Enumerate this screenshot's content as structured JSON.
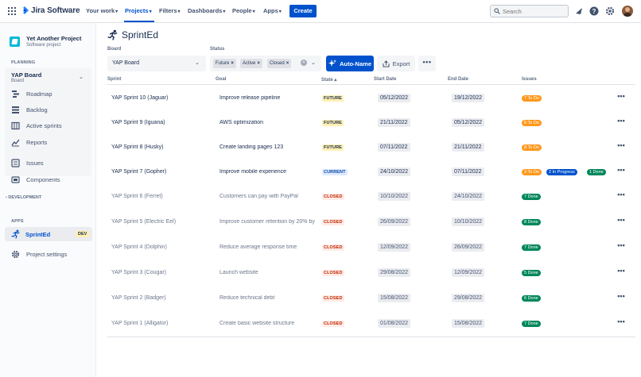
{
  "topnav": {
    "app_name": "Jira Software",
    "items": [
      {
        "label": "Your work",
        "chev": "▾"
      },
      {
        "label": "Projects",
        "chev": "▾"
      },
      {
        "label": "Filters",
        "chev": "▾"
      },
      {
        "label": "Dashboards",
        "chev": "▾"
      },
      {
        "label": "People",
        "chev": "▾"
      },
      {
        "label": "Apps",
        "chev": "▾"
      }
    ],
    "active_item": "Projects",
    "create_label": "Create",
    "search_placeholder": "Search",
    "icons": [
      "notifications-icon",
      "help-icon",
      "settings-icon"
    ],
    "accent": "#0052cc"
  },
  "sidebar": {
    "project_name": "Yet Another Project",
    "project_type": "Software project",
    "planning_label": "PLANNING",
    "board_title": "YAP Board",
    "board_sub": "Board",
    "planning_items": [
      {
        "label": "Roadmap",
        "icon": "roadmap-icon"
      },
      {
        "label": "Backlog",
        "icon": "backlog-icon"
      },
      {
        "label": "Active sprints",
        "icon": "board-icon"
      },
      {
        "label": "Reports",
        "icon": "reports-icon"
      }
    ],
    "other_items": [
      {
        "label": "Issues",
        "icon": "issues-icon"
      },
      {
        "label": "Components",
        "icon": "components-icon"
      }
    ],
    "development_label": "DEVELOPMENT",
    "apps_label": "APPS",
    "app_item": {
      "label": "SprintEd",
      "badge": "DEV"
    },
    "settings_label": "Project settings"
  },
  "main": {
    "title": "SprintEd",
    "board_label": "Board",
    "board_value": "YAP Board",
    "status_label": "Status",
    "status_chips": [
      "Future",
      "Active",
      "Closed"
    ],
    "autoname_label": "Auto-Name",
    "export_label": "Export",
    "more_label": "•••"
  },
  "table": {
    "headers": {
      "sprint": "Sprint",
      "goal": "Goal",
      "state": "State",
      "start": "Start Date",
      "end": "End Date",
      "issues": "Issues"
    },
    "rows": [
      {
        "name": "YAP Sprint 10 (Jaguar)",
        "goal": "Improve release pipeline",
        "state": "FUTURE",
        "start": "05/12/2022",
        "end": "19/12/2022",
        "badges": [
          {
            "text": "7 To Do",
            "kind": "todo"
          }
        ]
      },
      {
        "name": "YAP Sprint 9 (Iguana)",
        "goal": "AWS optimization",
        "state": "FUTURE",
        "start": "21/11/2022",
        "end": "05/12/2022",
        "badges": [
          {
            "text": "6 To Do",
            "kind": "todo"
          }
        ]
      },
      {
        "name": "YAP Sprint 8 (Husky)",
        "goal": "Create landing pages 123",
        "state": "FUTURE",
        "start": "07/11/2022",
        "end": "21/11/2022",
        "badges": [
          {
            "text": "8 To Do",
            "kind": "todo"
          }
        ]
      },
      {
        "name": "YAP Sprint 7 (Gopher)",
        "goal": "Improve mobile experience",
        "state": "CURRENT",
        "start": "24/10/2022",
        "end": "07/11/2022",
        "badges": [
          {
            "text": "3 To Do",
            "kind": "todo"
          },
          {
            "text": "2 In Progress",
            "kind": "prog"
          },
          {
            "text": "1 Done",
            "kind": "done"
          }
        ]
      },
      {
        "name": "YAP Sprint 6 (Ferret)",
        "goal": "Customers can pay with PayPal",
        "state": "CLOSED",
        "start": "10/10/2022",
        "end": "24/10/2022",
        "badges": [
          {
            "text": "7 Done",
            "kind": "done"
          }
        ]
      },
      {
        "name": "YAP Sprint 5 (Electric Eel)",
        "goal": "Improve customer retention by 20% by",
        "state": "CLOSED",
        "start": "26/09/2022",
        "end": "10/10/2022",
        "badges": [
          {
            "text": "8 Done",
            "kind": "done"
          }
        ]
      },
      {
        "name": "YAP Sprint 4 (Dolphin)",
        "goal": "Reduce average response time",
        "state": "CLOSED",
        "start": "12/09/2022",
        "end": "26/09/2022",
        "badges": [
          {
            "text": "7 Done",
            "kind": "done"
          }
        ]
      },
      {
        "name": "YAP Sprint 3 (Cougar)",
        "goal": "Launch website",
        "state": "CLOSED",
        "start": "29/08/2022",
        "end": "12/09/2022",
        "badges": [
          {
            "text": "5 Done",
            "kind": "done"
          }
        ]
      },
      {
        "name": "YAP Sprint 2 (Badger)",
        "goal": "Reduce technical debt",
        "state": "CLOSED",
        "start": "15/08/2022",
        "end": "29/08/2022",
        "badges": [
          {
            "text": "6 Done",
            "kind": "done"
          }
        ]
      },
      {
        "name": "YAP Sprint 1 (Alligator)",
        "goal": "Create basic website structure",
        "state": "CLOSED",
        "start": "01/08/2022",
        "end": "15/08/2022",
        "badges": [
          {
            "text": "7 Done",
            "kind": "done"
          }
        ]
      }
    ]
  }
}
